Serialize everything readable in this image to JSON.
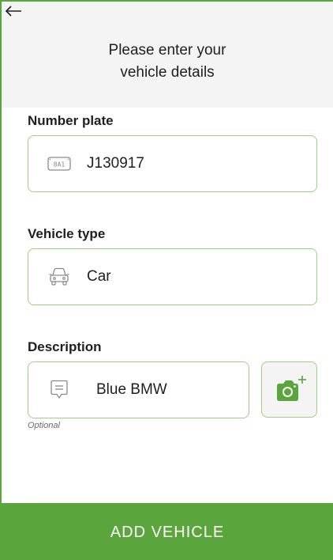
{
  "header": {
    "back_icon": "arrow-left-icon",
    "title_line1": "Please enter your",
    "title_line2": "vehicle details"
  },
  "number_plate": {
    "label": "Number plate",
    "icon": "license-plate-icon",
    "icon_text": "8A1",
    "value": "J130917"
  },
  "vehicle_type": {
    "label": "Vehicle type",
    "icon": "car-icon",
    "value": "Car"
  },
  "description": {
    "label": "Description",
    "icon": "comment-icon",
    "value": "Blue BMW",
    "hint": "Optional",
    "camera_icon": "camera-add-icon"
  },
  "actions": {
    "add_label": "ADD VEHICLE"
  },
  "colors": {
    "accent": "#5aa63c",
    "field_border": "#9bd17f",
    "header_bg": "#f4f4f4"
  }
}
